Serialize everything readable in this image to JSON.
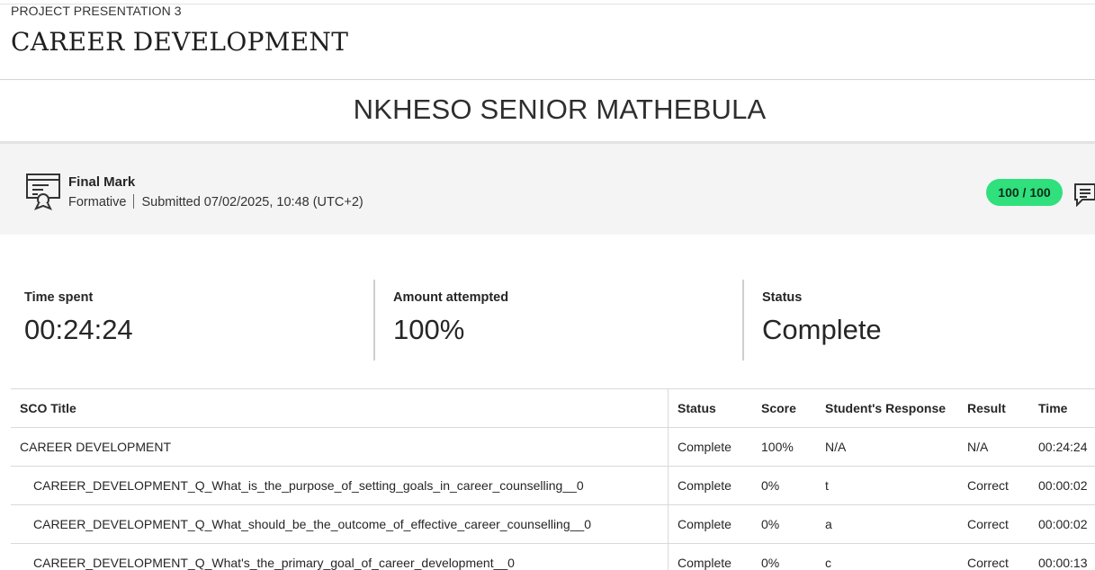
{
  "header": {
    "breadcrumb": "PROJECT PRESENTATION 3",
    "title": "CAREER DEVELOPMENT",
    "student_name": "NKHESO SENIOR MATHEBULA"
  },
  "grade": {
    "label": "Final Mark",
    "type": "Formative",
    "submitted": "Submitted 07/02/2025, 10:48 (UTC+2)",
    "score": "100 / 100",
    "score_color": "#2fe07d",
    "icons": [
      "certificate-icon",
      "comment-icon"
    ]
  },
  "stats": [
    {
      "label": "Time spent",
      "value": "00:24:24"
    },
    {
      "label": "Amount attempted",
      "value": "100%"
    },
    {
      "label": "Status",
      "value": "Complete"
    }
  ],
  "table": {
    "headers": {
      "title": "SCO Title",
      "status": "Status",
      "score": "Score",
      "response": "Student's Response",
      "result": "Result",
      "time": "Time"
    },
    "rows": [
      {
        "title": "CAREER DEVELOPMENT",
        "status": "Complete",
        "score": "100%",
        "response": "N/A",
        "result": "N/A",
        "time": "00:24:24"
      },
      {
        "title": "CAREER_DEVELOPMENT_Q_What_is_the_purpose_of_setting_goals_in_career_counselling__0",
        "status": "Complete",
        "score": "0%",
        "response": "t",
        "result": "Correct",
        "time": "00:00:02"
      },
      {
        "title": "CAREER_DEVELOPMENT_Q_What_should_be_the_outcome_of_effective_career_counselling__0",
        "status": "Complete",
        "score": "0%",
        "response": "a",
        "result": "Correct",
        "time": "00:00:02"
      },
      {
        "title": "CAREER_DEVELOPMENT_Q_What's_the_primary_goal_of_career_development__0",
        "status": "Complete",
        "score": "0%",
        "response": "c",
        "result": "Correct",
        "time": "00:00:13"
      }
    ]
  }
}
